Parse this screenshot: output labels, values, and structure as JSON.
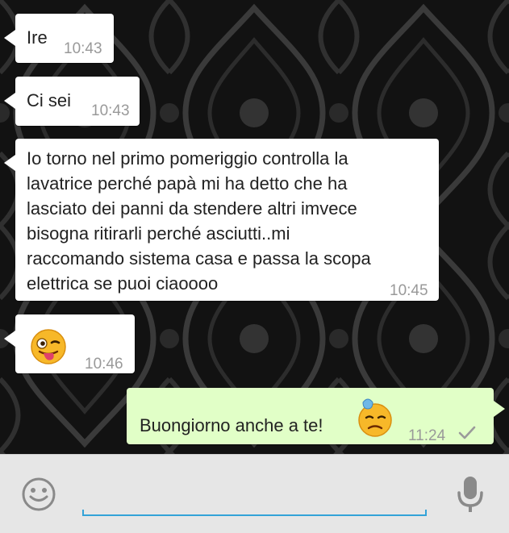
{
  "messages": [
    {
      "direction": "incoming",
      "text": "Ire",
      "time": "10:43"
    },
    {
      "direction": "incoming",
      "text": "Ci sei",
      "time": "10:43"
    },
    {
      "direction": "incoming",
      "text": "Io torno nel primo pomeriggio controlla la\nlavatrice perché papà mi ha detto che ha\nlasciato dei panni da stendere altri imvece\nbisogna ritirarli perché asciutti..mi\nraccomando sistema casa e passa la scopa\nelettrica se puoi ciaoooo",
      "time": "10:45"
    },
    {
      "direction": "incoming",
      "emoji": "winking-tongue-emoji",
      "text": "",
      "time": "10:46"
    },
    {
      "direction": "outgoing",
      "text": "Buongiorno anche a te!",
      "emoji": "cold-sweat-emoji",
      "time": "11:24",
      "status": "sent-check-icon"
    }
  ],
  "input": {
    "placeholder": "",
    "value": "",
    "left_icon": "emoji-icon",
    "right_icon": "microphone-icon"
  },
  "colors": {
    "incoming": "#ffffff",
    "outgoing": "#e1ffc7",
    "accent": "#33a3d8"
  }
}
